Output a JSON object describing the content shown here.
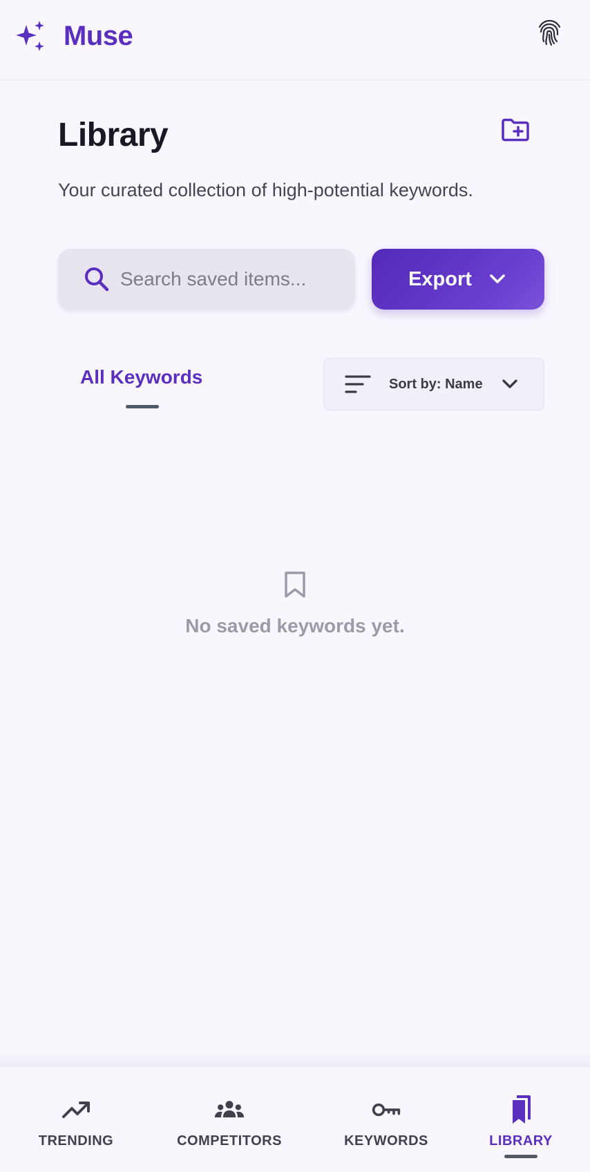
{
  "app": {
    "name": "Muse"
  },
  "page": {
    "title": "Library",
    "subtitle": "Your curated collection of high-potential keywords."
  },
  "search": {
    "placeholder": "Search saved items...",
    "value": ""
  },
  "export": {
    "label": "Export"
  },
  "tabs": [
    {
      "label": "All Keywords",
      "active": true
    }
  ],
  "sort": {
    "label": "Sort by: Name"
  },
  "empty_state": {
    "message": "No saved keywords yet."
  },
  "bottom_nav": {
    "items": [
      {
        "label": "TRENDING",
        "icon": "trending-up-icon",
        "active": false
      },
      {
        "label": "COMPETITORS",
        "icon": "groups-icon",
        "active": false
      },
      {
        "label": "KEYWORDS",
        "icon": "key-icon",
        "active": false
      },
      {
        "label": "LIBRARY",
        "icon": "bookmarks-icon",
        "active": true
      }
    ]
  },
  "colors": {
    "accent": "#5a2fc0",
    "background": "#f9f7fd",
    "muted_text": "#9c9aa5"
  }
}
